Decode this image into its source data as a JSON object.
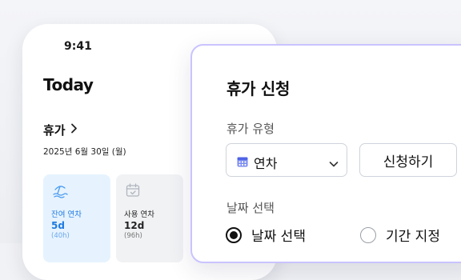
{
  "phone": {
    "status_time": "9:41",
    "title": "Today",
    "vacation_link": "휴가",
    "date": "2025년 6월 30일 (월)",
    "cards": [
      {
        "label": "잔여 연차",
        "value": "5d",
        "sub": "(40h)"
      },
      {
        "label": "사용 연차",
        "value": "12d",
        "sub": "(96h)"
      }
    ]
  },
  "dialog": {
    "title": "휴가 신청",
    "type_label": "휴가 유형",
    "type_value": "연차",
    "apply_button": "신청하기",
    "date_label": "날짜 선택",
    "radio_options": [
      "날짜 선택",
      "기간 지정"
    ],
    "selected_option": "날짜 선택"
  },
  "colors": {
    "accent_blue": "#1f7ae0",
    "dialog_border": "#c9c3ff"
  }
}
